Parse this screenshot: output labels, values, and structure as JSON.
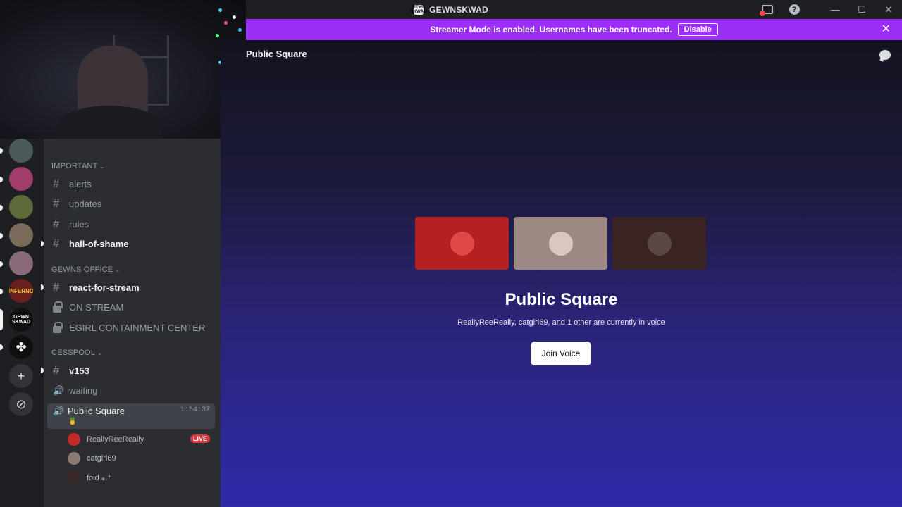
{
  "window": {
    "title": "GEWNSKWAD",
    "logo_text": "GEWN SKWAD",
    "help_glyph": "?",
    "minimize_glyph": "—",
    "maximize_glyph": "☐",
    "close_glyph": "✕"
  },
  "banner": {
    "text": "Streamer Mode is enabled. Usernames have been truncated.",
    "disable_label": "Disable",
    "close_glyph": "✕",
    "color": "#9c2ff5"
  },
  "rail": {
    "servers": [
      {
        "name": "server-1",
        "color": "#4a5a5a"
      },
      {
        "name": "server-2",
        "color": "#a13d6a"
      },
      {
        "name": "server-3",
        "color": "#5d6a3a"
      },
      {
        "name": "server-4",
        "color": "#7a6a5a"
      },
      {
        "name": "server-5",
        "color": "#8a6a7a"
      },
      {
        "name": "server-6",
        "color": "#6a1f1f",
        "text": "INFERNO"
      },
      {
        "name": "server-7",
        "color": "#111111",
        "text": "GEWN SKWAD"
      },
      {
        "name": "server-8",
        "color": "#0f0f0f",
        "text": "✤"
      }
    ],
    "add_glyph": "+",
    "explore_glyph": "⊘"
  },
  "sidebar": {
    "categories": {
      "important": "IMPORTANT",
      "office": "GEWNS OFFICE",
      "cesspool": "CESSPOOL"
    },
    "chevron": "⌄",
    "channels": {
      "alerts": "alerts",
      "updates": "updates",
      "rules": "rules",
      "hall_of_shame": "hall-of-shame",
      "react_for_stream": "react-for-stream",
      "on_stream": "ON STREAM",
      "egirl": "EGIRL CONTAINMENT CENTER",
      "v153": "v153",
      "waiting": "waiting"
    },
    "hash_glyph": "#",
    "speaker_glyph": "🔊",
    "active_voice": {
      "name": "Public Square",
      "timer": "1:54:37",
      "status": "🍍"
    },
    "voice_users": [
      {
        "name": "ReallyReeReally",
        "live": "LIVE",
        "color": "#c52a2a"
      },
      {
        "name": "catgirl69",
        "live": "",
        "color": "#8a7a72"
      },
      {
        "name": "foid ⁎.⁺",
        "live": "",
        "color": "#3a2824"
      }
    ]
  },
  "main": {
    "header": "Public Square",
    "title": "Public Square",
    "subtitle": "ReallyReeReally, catgirl69, and 1 other are currently in voice",
    "join_label": "Join Voice",
    "tiles": [
      {
        "color": "#b52022",
        "avatar": "#e04848"
      },
      {
        "color": "#9c8882",
        "avatar": "#d8c8c0"
      },
      {
        "color": "#3a2422",
        "avatar": "#5a4844"
      }
    ]
  }
}
